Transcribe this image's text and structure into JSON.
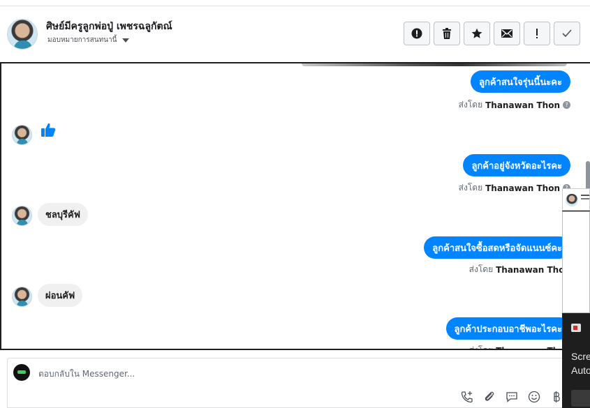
{
  "header": {
    "title": "ศิษย์มีครูลูกพ่อปู่ เพชรฉลูกัตณ์",
    "assign_label": "มอบหมายการสนทนานี้",
    "actions": [
      {
        "icon": "alert-circle-icon",
        "glyph": "!"
      },
      {
        "icon": "trash-icon",
        "glyph": "🗑"
      },
      {
        "icon": "star-icon",
        "glyph": "★"
      },
      {
        "icon": "envelope-icon",
        "glyph": "✉"
      },
      {
        "icon": "exclamation-icon",
        "glyph": "!"
      },
      {
        "icon": "check-icon",
        "glyph": "✓"
      }
    ]
  },
  "messages": {
    "out1": "ลูกค้าสนใจรุ่นนี้นะคะ",
    "out2": "ลูกค้าอยู่จังหวัดอะไรคะ",
    "out3": "ลูกค้าสนใจซื้อสดหรือจัดแนนซ์คะ",
    "out4": "ลูกค้าประกอบอาชีพอะไรคะ",
    "in1": "ชลบุรีคัฟ",
    "in2": "ผ่อนคัฟ",
    "sent_by_prefix": "ส่งโดย",
    "sent_by_name": "Thanawan Thon"
  },
  "composer": {
    "placeholder": "ตอบกลับใน Messenger...",
    "tools": [
      "phone-plus-icon",
      "paperclip-icon",
      "chat-bubble-icon",
      "smiley-icon",
      "baht-icon"
    ]
  },
  "overlay": {
    "line1": "Scre",
    "line2": "Auto"
  },
  "colors": {
    "accent": "#0084ff",
    "incoming_bubble": "#f1f0f0"
  }
}
